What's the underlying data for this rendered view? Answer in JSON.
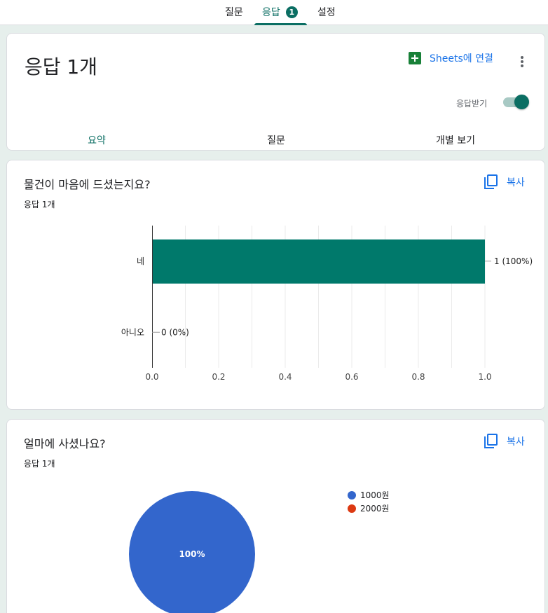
{
  "top_tabs": {
    "questions": "질문",
    "responses": "응답",
    "responses_badge": "1",
    "settings": "설정"
  },
  "header": {
    "title": "응답 1개",
    "sheets_link": "Sheets에 연결",
    "more_icon": "more-vert-icon",
    "accepting_label": "응답받기",
    "accepting_on": true,
    "subtabs": [
      "요약",
      "질문",
      "개별 보기"
    ],
    "active_subtab": "요약"
  },
  "questions": [
    {
      "title": "물건이 마음에 드셨는지요?",
      "count": "응답 1개",
      "copy_label": "복사"
    },
    {
      "title": "얼마에 사셨나요?",
      "count": "응답 1개",
      "copy_label": "복사"
    }
  ],
  "colors": {
    "accent": "#0b6e63",
    "bar": "#00796b",
    "link": "#1a73e8",
    "pie_1000": "#3366cc",
    "pie_2000": "#dc3912"
  },
  "chart_data": [
    {
      "type": "bar",
      "orientation": "horizontal",
      "categories": [
        "네",
        "아니오"
      ],
      "values": [
        1,
        0
      ],
      "data_labels": [
        "1 (100%)",
        "0 (0%)"
      ],
      "xlim": [
        0,
        1
      ],
      "xticks": [
        "0.0",
        "0.2",
        "0.4",
        "0.6",
        "0.8",
        "1.0"
      ],
      "grid": true
    },
    {
      "type": "pie",
      "categories": [
        "1000원",
        "2000원"
      ],
      "values": [
        1,
        0
      ],
      "slice_labels": [
        "100%",
        ""
      ],
      "legend": "right"
    }
  ]
}
